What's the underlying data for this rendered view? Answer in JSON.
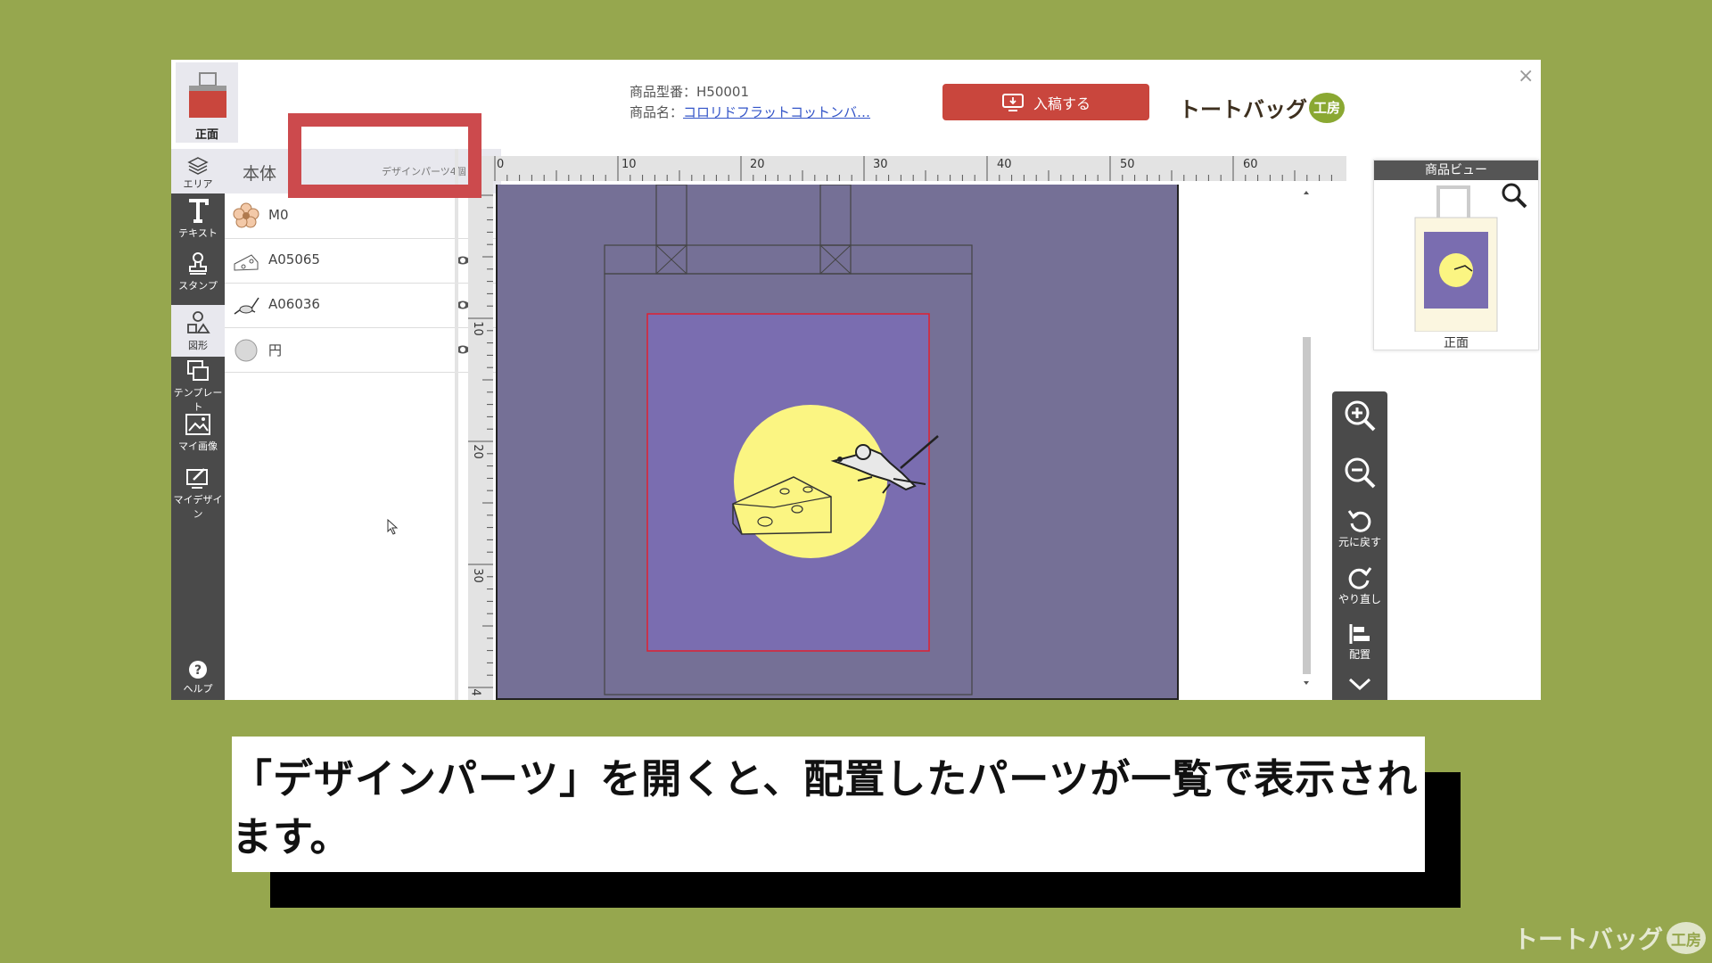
{
  "header": {
    "face_tab_label": "正面",
    "product_code_label": "商品型番：",
    "product_code": "H50001",
    "product_name_label": "商品名：",
    "product_name": "コロリドフラットコットンバ…",
    "submit_label": "入稿する",
    "brand_name": "トートバッグ",
    "brand_badge": "工房",
    "close_symbol": "×"
  },
  "toolbar": {
    "area_label": "エリア",
    "items": [
      {
        "label": "テキスト",
        "icon": "text-icon"
      },
      {
        "label": "スタンプ",
        "icon": "stamp-icon"
      },
      {
        "label": "図形",
        "icon": "shapes-icon"
      },
      {
        "label": "テンプレート",
        "icon": "template-icon"
      },
      {
        "label": "マイ画像",
        "icon": "image-icon"
      },
      {
        "label": "マイデザイン",
        "icon": "my-design-icon"
      }
    ],
    "help_label": "ヘルプ"
  },
  "panel": {
    "title": "本体",
    "parts_toggle": "デザインパーツ4個",
    "layers": [
      {
        "name": "M0",
        "icon": "flower-thumb-icon"
      },
      {
        "name": "A05065",
        "icon": "cheese-thumb-icon"
      },
      {
        "name": "A06036",
        "icon": "mouse-thumb-icon"
      },
      {
        "name": "円",
        "icon": "circle-thumb-icon"
      }
    ]
  },
  "rulers": {
    "top": [
      "0",
      "10",
      "20",
      "30",
      "40",
      "50",
      "60"
    ],
    "left": [
      "10",
      "20",
      "30",
      "4"
    ]
  },
  "zoom": {
    "undo_label": "元に戻す",
    "redo_label": "やり直し",
    "align_label": "配置"
  },
  "product_view": {
    "title": "商品ビュー",
    "face_label": "正面"
  },
  "caption": "「デザインパーツ」を開くと、配置したパーツが一覧で表示されます。",
  "footer": {
    "brand_name": "トートバッグ",
    "brand_badge": "工房"
  },
  "colors": {
    "background": "#96a74e",
    "accent_red": "#c9463d",
    "highlight": "#cc4a4d",
    "canvas": "#757096",
    "print_area": "#7a6db0",
    "moon": "#fbf582",
    "toolbar": "#4a4a4a"
  }
}
